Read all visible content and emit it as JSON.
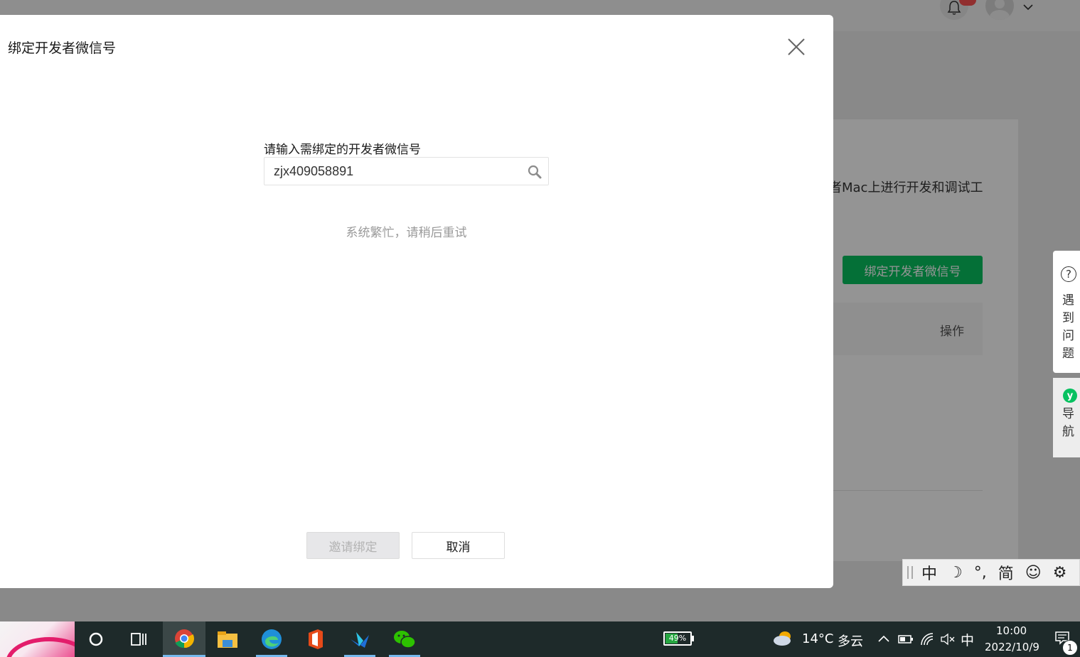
{
  "dialog": {
    "title": "绑定开发者微信号",
    "field_label": "请输入需绑定的开发者微信号",
    "input_value": "zjx409058891",
    "error_message": "系统繁忙，请稍后重试",
    "invite_button": "邀请绑定",
    "cancel_button": "取消"
  },
  "background": {
    "description_fragment": "者Mac上进行开发和调试工",
    "bind_button": "绑定开发者微信号",
    "column_operation": "操作"
  },
  "side_help": {
    "help_icon_glyph": "?",
    "help_text": "遇到问题",
    "nav_icon_glyph": "y",
    "nav_text": "导航"
  },
  "ime_bar": {
    "mode": "中",
    "moon": "☽",
    "punct": "°,",
    "simplified": "简",
    "emoji": "☺",
    "settings": "⚙"
  },
  "taskbar": {
    "battery": "49%",
    "battery_level": 0.49,
    "weather_temp": "14°C",
    "weather_desc": "多云",
    "input_method": "中",
    "time": "10:00",
    "date": "2022/10/9",
    "notification_count": "1",
    "colors": {
      "accent": "#07c160",
      "taskbar": "#1e2a2a",
      "active_underline": "#76b9ed"
    }
  }
}
